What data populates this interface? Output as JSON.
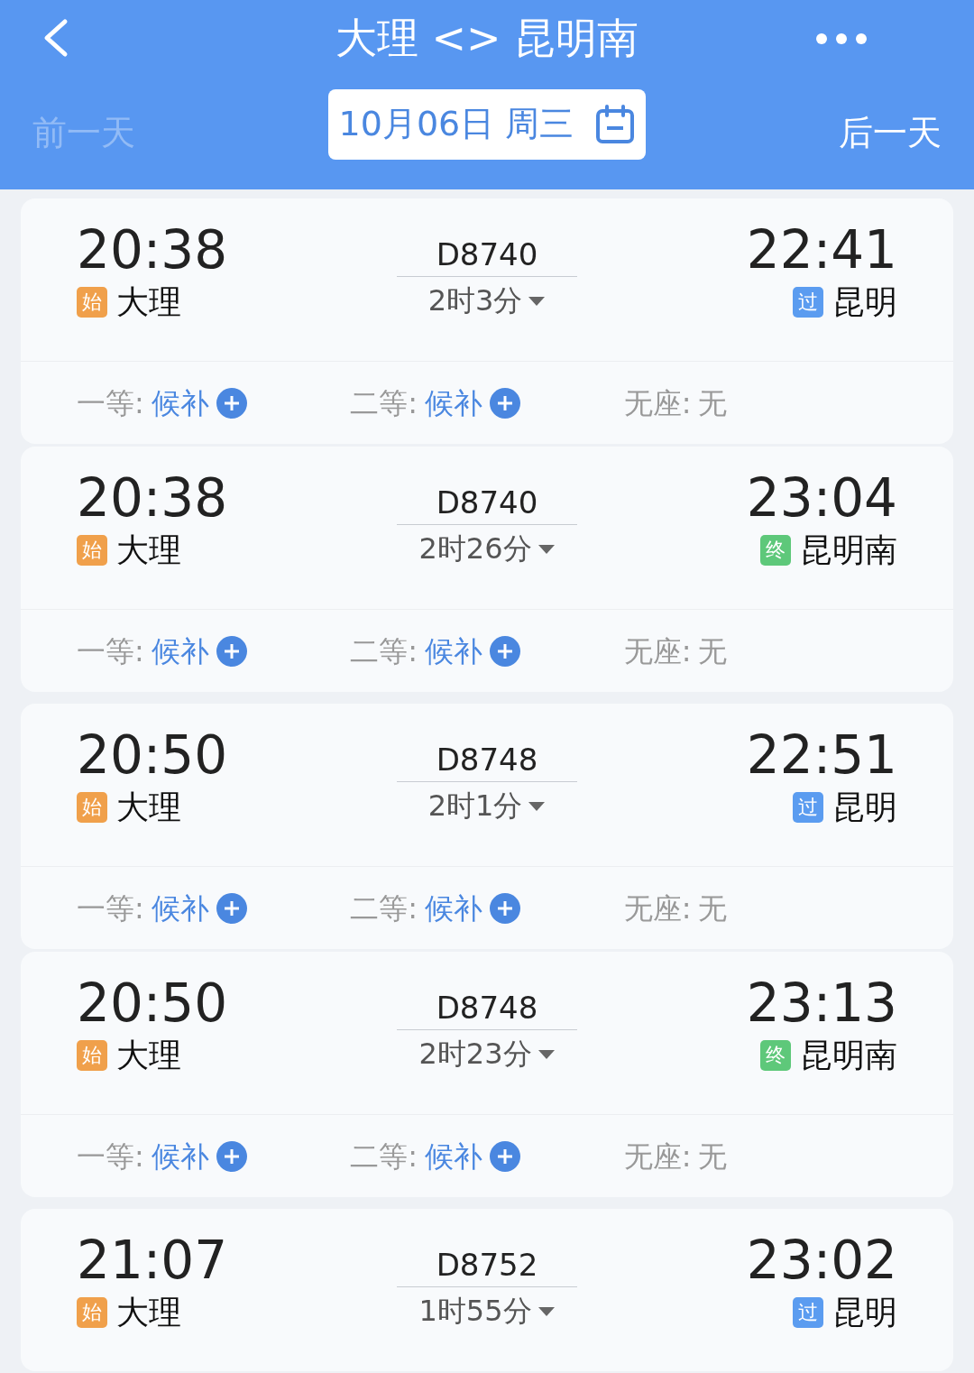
{
  "header": {
    "title": "大理 <> 昆明南",
    "prev_day": {
      "label": "前一天",
      "disabled": true
    },
    "date": "10月06日 周三",
    "next_day": {
      "label": "后一天",
      "disabled": false
    }
  },
  "trains": [
    {
      "depart": "20:38",
      "from_badge": {
        "text": "始",
        "color": "#f0a04b"
      },
      "from": "大理",
      "number": "D8740",
      "duration": "2时3分",
      "arrive": "22:41",
      "to_badge": {
        "text": "过",
        "color": "#5b9cf0"
      },
      "to": "昆明",
      "seats": [
        {
          "label": "一等:",
          "value": "候补",
          "kind": "waitlist"
        },
        {
          "label": "二等:",
          "value": "候补",
          "kind": "waitlist"
        },
        {
          "label": "无座:",
          "value": "无",
          "kind": "plain"
        }
      ]
    },
    {
      "depart": "20:38",
      "from_badge": {
        "text": "始",
        "color": "#f0a04b"
      },
      "from": "大理",
      "number": "D8740",
      "duration": "2时26分",
      "arrive": "23:04",
      "to_badge": {
        "text": "终",
        "color": "#5ec87a"
      },
      "to": "昆明南",
      "seats": [
        {
          "label": "一等:",
          "value": "候补",
          "kind": "waitlist"
        },
        {
          "label": "二等:",
          "value": "候补",
          "kind": "waitlist"
        },
        {
          "label": "无座:",
          "value": "无",
          "kind": "plain"
        }
      ]
    },
    {
      "depart": "20:50",
      "from_badge": {
        "text": "始",
        "color": "#f0a04b"
      },
      "from": "大理",
      "number": "D8748",
      "duration": "2时1分",
      "arrive": "22:51",
      "to_badge": {
        "text": "过",
        "color": "#5b9cf0"
      },
      "to": "昆明",
      "seats": [
        {
          "label": "一等:",
          "value": "候补",
          "kind": "waitlist"
        },
        {
          "label": "二等:",
          "value": "候补",
          "kind": "waitlist"
        },
        {
          "label": "无座:",
          "value": "无",
          "kind": "plain"
        }
      ]
    },
    {
      "depart": "20:50",
      "from_badge": {
        "text": "始",
        "color": "#f0a04b"
      },
      "from": "大理",
      "number": "D8748",
      "duration": "2时23分",
      "arrive": "23:13",
      "to_badge": {
        "text": "终",
        "color": "#5ec87a"
      },
      "to": "昆明南",
      "seats": [
        {
          "label": "一等:",
          "value": "候补",
          "kind": "waitlist"
        },
        {
          "label": "二等:",
          "value": "候补",
          "kind": "waitlist"
        },
        {
          "label": "无座:",
          "value": "无",
          "kind": "plain"
        }
      ]
    },
    {
      "depart": "21:07",
      "from_badge": {
        "text": "始",
        "color": "#f0a04b"
      },
      "from": "大理",
      "number": "D8752",
      "duration": "1时55分",
      "arrive": "23:02",
      "to_badge": {
        "text": "过",
        "color": "#5b9cf0"
      },
      "to": "昆明"
    }
  ]
}
